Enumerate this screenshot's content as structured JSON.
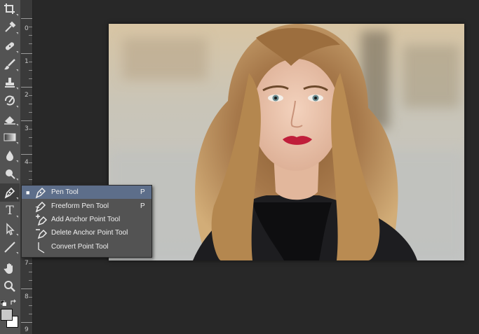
{
  "toolbar": {
    "tools": [
      {
        "name": "crop-icon"
      },
      {
        "name": "eyedropper-icon"
      },
      {
        "name": "healing-brush-icon"
      },
      {
        "name": "brush-icon"
      },
      {
        "name": "clone-stamp-icon"
      },
      {
        "name": "history-brush-icon"
      },
      {
        "name": "eraser-icon"
      },
      {
        "name": "gradient-icon"
      },
      {
        "name": "blur-icon"
      },
      {
        "name": "dodge-icon"
      },
      {
        "name": "pen-icon"
      },
      {
        "name": "type-icon"
      },
      {
        "name": "path-selection-icon"
      },
      {
        "name": "line-icon"
      },
      {
        "name": "hand-icon"
      },
      {
        "name": "zoom-icon"
      }
    ],
    "type_glyph": "T",
    "foreground_color": "#c8c8c8",
    "background_color": "#ffffff"
  },
  "ruler": {
    "numbers": [
      "0",
      "1",
      "2",
      "3",
      "4",
      "7",
      "8",
      "9"
    ]
  },
  "flyout": {
    "items": [
      {
        "label": "Pen Tool",
        "shortcut": "P",
        "selected": true,
        "bullet": "■",
        "icon": "pen-icon"
      },
      {
        "label": "Freeform Pen Tool",
        "shortcut": "P",
        "selected": false,
        "bullet": "",
        "icon": "freeform-pen-icon"
      },
      {
        "label": "Add Anchor Point Tool",
        "shortcut": "",
        "selected": false,
        "bullet": "",
        "icon": "add-anchor-point-icon"
      },
      {
        "label": "Delete Anchor Point Tool",
        "shortcut": "",
        "selected": false,
        "bullet": "",
        "icon": "delete-anchor-point-icon"
      },
      {
        "label": "Convert Point Tool",
        "shortcut": "",
        "selected": false,
        "bullet": "",
        "icon": "convert-point-icon"
      }
    ]
  },
  "canvas": {
    "image_name": "portrait-photo"
  }
}
